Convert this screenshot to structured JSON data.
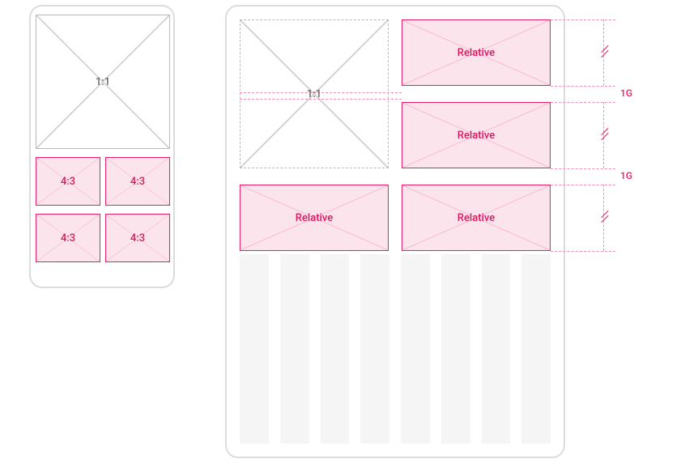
{
  "phone": {
    "hero_label": "1:1",
    "tiles": [
      "4:3",
      "4:3",
      "4:3",
      "4:3"
    ]
  },
  "tablet": {
    "hero_label": "1:1",
    "tiles": [
      "Relative",
      "Relative",
      "Relative",
      "Relative"
    ],
    "gap_labels": [
      "1G",
      "1G"
    ]
  }
}
